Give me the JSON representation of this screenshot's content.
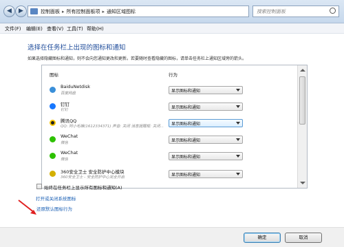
{
  "address": {
    "crumbs": [
      "控制面板",
      "所有控制面板项",
      "通知区域图标"
    ],
    "search_placeholder": "搜索控制面板"
  },
  "menu": [
    "文件(F)",
    "编辑(E)",
    "查看(V)",
    "工具(T)",
    "帮助(H)"
  ],
  "page": {
    "title": "选择在任务栏上出现的图标和通知",
    "description": "如果选择隐藏图标和通知，则不会向您通知更改和更新。若要随时查看隐藏的图标，请单击任务栏上通知区域旁的箭头。"
  },
  "table": {
    "col_icon": "图标",
    "col_behavior": "行为",
    "rows": [
      {
        "name": "BaiduNetdisk",
        "sub": "百度网盘",
        "behavior": "显示图标和通知",
        "icon": "baidu-netdisk-icon",
        "color": "#3a8fd9"
      },
      {
        "name": "钉钉",
        "sub": "钉钉",
        "behavior": "显示图标和通知",
        "icon": "dingtalk-icon",
        "color": "#1677ff"
      },
      {
        "name": "腾讯QQ",
        "sub": "QQ: 阿小毛嘛(1612334371)  声音: 关闭  消息提醒框: 关闭...",
        "behavior": "显示图标和通知",
        "icon": "qq-penguin-icon",
        "color": "#222222",
        "selected": true
      },
      {
        "name": "WeChat",
        "sub": "微信",
        "behavior": "显示图标和通知",
        "icon": "wechat-icon",
        "color": "#2dc100"
      },
      {
        "name": "WeChat",
        "sub": "微信",
        "behavior": "显示图标和通知",
        "icon": "wechat-icon",
        "color": "#2dc100"
      },
      {
        "name": "360安全卫士 安全防护中心模块",
        "sub": "360安全卫士 - 安全防护中心完全开启",
        "behavior": "显示图标和通知",
        "icon": "360-safe-icon",
        "color": "#d4b000"
      }
    ]
  },
  "links": {
    "system_icons": "打开或关闭系统图标",
    "restore": "还原默认图标行为"
  },
  "checkbox": {
    "label": "始终在任务栏上显示所有图标和通知(A)"
  },
  "buttons": {
    "ok": "确定",
    "cancel": "取消"
  }
}
